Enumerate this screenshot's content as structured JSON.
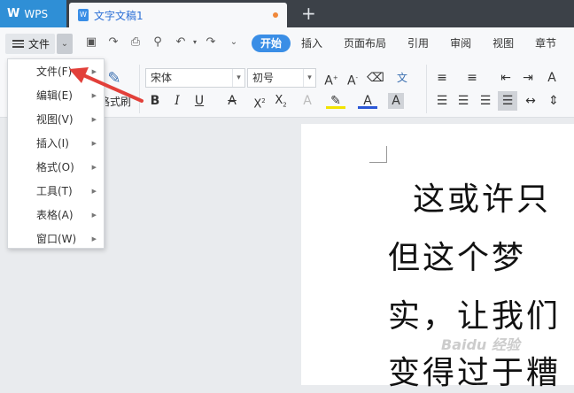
{
  "titlebar": {
    "wps_tab": "WPS",
    "doc_tab": "文字文稿1",
    "new_tab_symbol": "+"
  },
  "toolbar": {
    "file_label": "文件",
    "menu_tabs": [
      "开始",
      "插入",
      "页面布局",
      "引用",
      "审阅",
      "视图",
      "章节"
    ]
  },
  "ribbon": {
    "format_painter_label": "格式刷",
    "font_name": "宋体",
    "font_size": "初号"
  },
  "file_menu": {
    "items": [
      "文件(F)",
      "编辑(E)",
      "视图(V)",
      "插入(I)",
      "格式(O)",
      "工具(T)",
      "表格(A)",
      "窗口(W)"
    ]
  },
  "document": {
    "lines": [
      "这或许只",
      "但这个梦",
      "实，让我们",
      "变得过于糟"
    ]
  },
  "colors": {
    "accent": "#3a8ee6",
    "wps_tab": "#2f8fd6",
    "arrow": "#e2403a"
  }
}
